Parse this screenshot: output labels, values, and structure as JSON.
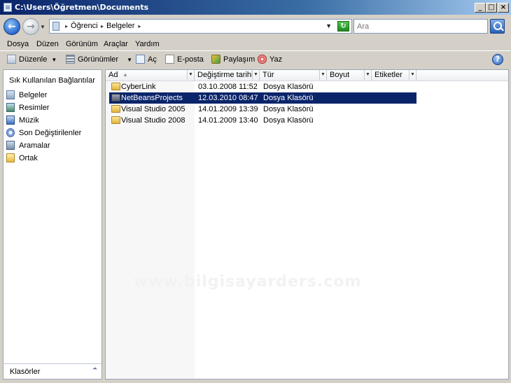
{
  "window": {
    "title": "C:\\Users\\Öğretmen\\Documents"
  },
  "titlebar_buttons": {
    "minimize": "_",
    "maximize": "□",
    "close": "×"
  },
  "address": {
    "crumbs": [
      "Öğrenci",
      "Belgeler"
    ],
    "search_placeholder": "Ara"
  },
  "menu": [
    "Dosya",
    "Düzen",
    "Görünüm",
    "Araçlar",
    "Yardım"
  ],
  "toolbar": {
    "organize": "Düzenle",
    "views": "Görünümler",
    "open": "Aç",
    "email": "E-posta",
    "share": "Paylaşım",
    "burn": "Yaz",
    "help": "?"
  },
  "nav": {
    "heading": "Sık Kullanılan Bağlantılar",
    "items": [
      {
        "label": "Belgeler",
        "icon": "documents-icon"
      },
      {
        "label": "Resimler",
        "icon": "pictures-icon"
      },
      {
        "label": "Müzik",
        "icon": "music-icon"
      },
      {
        "label": "Son Değiştirilenler",
        "icon": "recent-icon"
      },
      {
        "label": "Aramalar",
        "icon": "searches-icon"
      },
      {
        "label": "Ortak",
        "icon": "public-folder-icon"
      }
    ],
    "folders_label": "Klasörler"
  },
  "columns": [
    "Ad",
    "Değiştirme tarihi",
    "Tür",
    "Boyut",
    "Etiketler"
  ],
  "files": [
    {
      "name": "CyberLink",
      "modified": "03.10.2008 11:52",
      "type": "Dosya Klasörü",
      "selected": false
    },
    {
      "name": "NetBeansProjects",
      "modified": "12.03.2010 08:47",
      "type": "Dosya Klasörü",
      "selected": true
    },
    {
      "name": "Visual Studio 2005",
      "modified": "14.01.2009 13:39",
      "type": "Dosya Klasörü",
      "selected": false
    },
    {
      "name": "Visual Studio 2008",
      "modified": "14.01.2009 13:40",
      "type": "Dosya Klasörü",
      "selected": false
    }
  ],
  "watermark": "www.bilgisayarders.com"
}
